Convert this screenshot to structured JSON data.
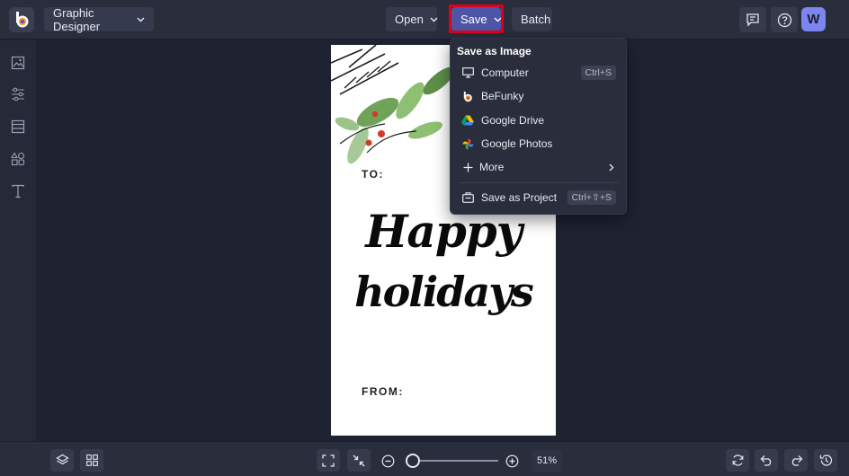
{
  "topbar": {
    "designer_label": "Graphic Designer",
    "open_label": "Open",
    "save_label": "Save",
    "batch_label": "Batch",
    "avatar_letter": "W"
  },
  "left_rail": {
    "icons": [
      "image-icon",
      "sliders-icon",
      "layout-icon",
      "shapes-icon",
      "text-icon"
    ]
  },
  "canvas": {
    "to_label": "TO:",
    "headline_line1": "Happy",
    "headline_line2": "holidays",
    "from_label": "FROM:"
  },
  "save_menu": {
    "heading": "Save as Image",
    "items": [
      {
        "label": "Computer",
        "shortcut": "Ctrl+S",
        "icon": "monitor-icon"
      },
      {
        "label": "BeFunky",
        "icon": "befunky-icon"
      },
      {
        "label": "Google Drive",
        "icon": "google-drive-icon"
      },
      {
        "label": "Google Photos",
        "icon": "google-photos-icon"
      },
      {
        "label": "More",
        "icon": "plus-icon"
      },
      {
        "label": "Save as Project",
        "shortcut": "Ctrl+⇧+S",
        "icon": "project-icon"
      }
    ]
  },
  "bottombar": {
    "zoom_value": "51%",
    "zoom_fraction": 0.05
  },
  "colors": {
    "accent": "#4f55a6",
    "highlight_outline": "#e0001b",
    "avatar": "#7b86f0"
  }
}
